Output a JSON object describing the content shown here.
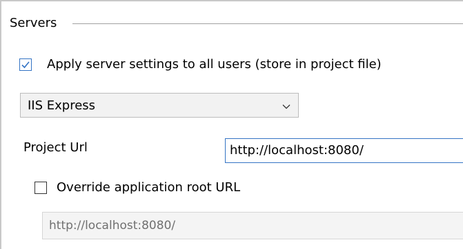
{
  "servers_group": {
    "title": "Servers"
  },
  "apply_settings": {
    "checked": true,
    "label": "Apply server settings to all users (store in project file)"
  },
  "server_select": {
    "selected": "IIS Express"
  },
  "project_url": {
    "label": "Project Url",
    "value": "http://localhost:8080/"
  },
  "override_root": {
    "checked": false,
    "label": "Override application root URL",
    "value": "http://localhost:8080/"
  },
  "colors": {
    "accent": "#3373c4",
    "disabled_text": "#707070"
  }
}
